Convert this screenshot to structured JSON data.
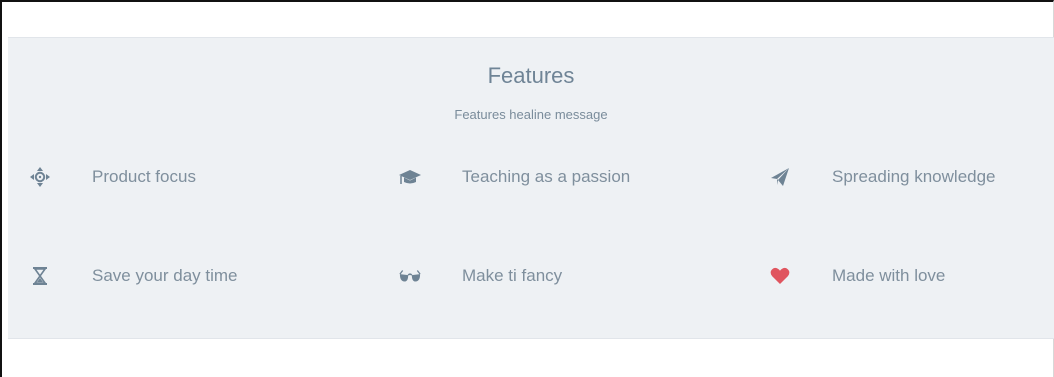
{
  "section": {
    "title": "Features",
    "subtitle": "Features healine message"
  },
  "colors": {
    "background": "#eef1f4",
    "heading": "#6f8496",
    "text": "#7f8f9d",
    "icon": "#6e8394",
    "heart": "#e0555f"
  },
  "features": [
    {
      "icon": "crosshair-move-icon",
      "label": "Product focus"
    },
    {
      "icon": "graduation-cap-icon",
      "label": "Teaching as a passion"
    },
    {
      "icon": "paper-plane-icon",
      "label": "Spreading knowledge"
    },
    {
      "icon": "hourglass-icon",
      "label": "Save your day time"
    },
    {
      "icon": "sunglasses-icon",
      "label": "Make ti fancy"
    },
    {
      "icon": "heart-icon",
      "label": "Made with love"
    }
  ]
}
